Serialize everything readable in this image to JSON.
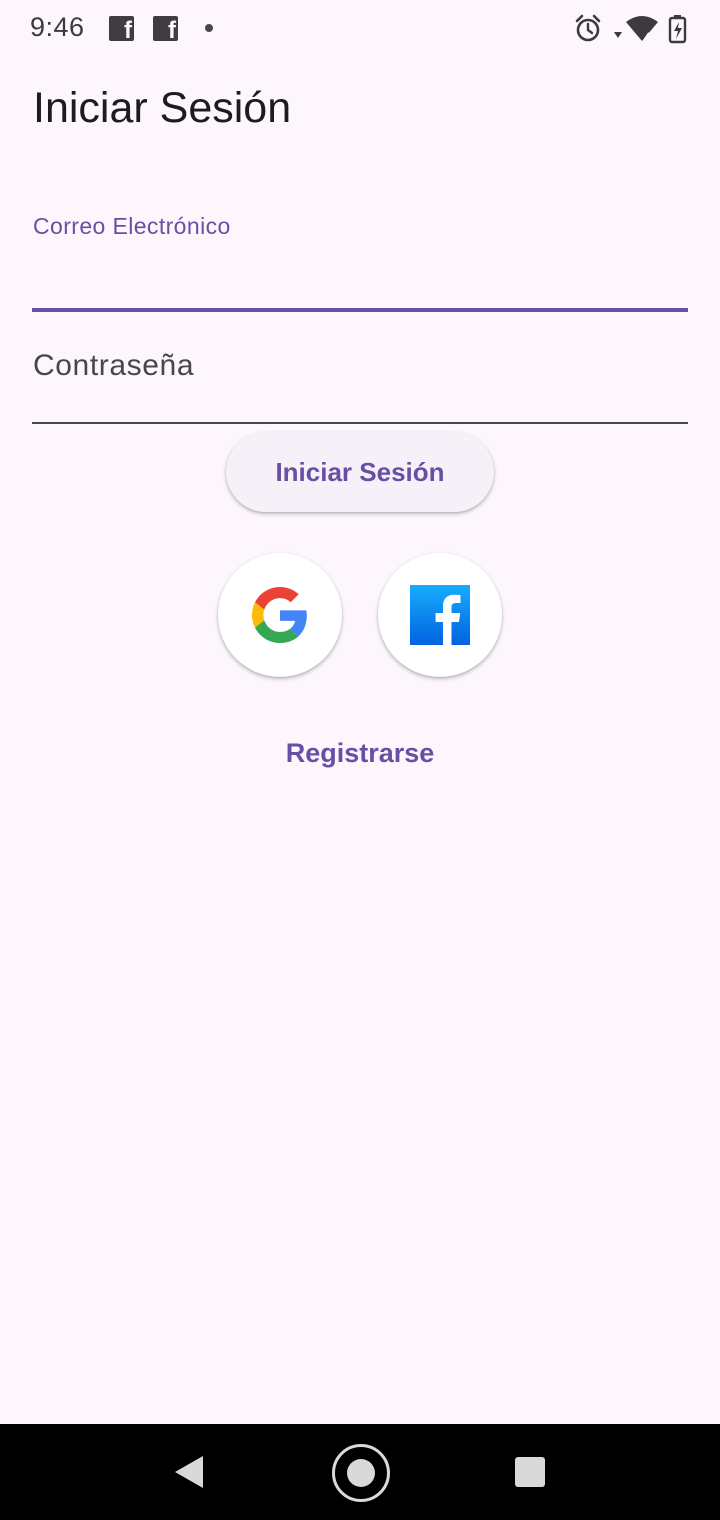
{
  "status_bar": {
    "time": "9:46",
    "battery_level_label": "4",
    "icons": [
      "facebook-notification-icon",
      "facebook-notification-icon",
      "notification-dot-icon",
      "alarm-icon",
      "wifi-icon",
      "battery-charging-icon"
    ]
  },
  "page": {
    "title": "Iniciar Sesión"
  },
  "form": {
    "email_label": "Correo Electrónico",
    "email_value": "",
    "password_label": "Contraseña",
    "password_value": "",
    "submit_label": "Iniciar Sesión"
  },
  "social": {
    "google_icon": "google-logo-icon",
    "facebook_icon": "facebook-logo-icon"
  },
  "register_label": "Registrarse",
  "colors": {
    "background": "#fdf7fd",
    "primary": "#6750a4",
    "text": "#1d1b20",
    "muted_text": "#49454f",
    "google_blue": "#4285f4",
    "google_red": "#ea4335",
    "google_yellow": "#fbbc05",
    "google_green": "#34a853",
    "facebook_blue": "#1877f2"
  },
  "nav_bar": {
    "icons": [
      "back-icon",
      "home-icon",
      "recents-icon"
    ]
  }
}
